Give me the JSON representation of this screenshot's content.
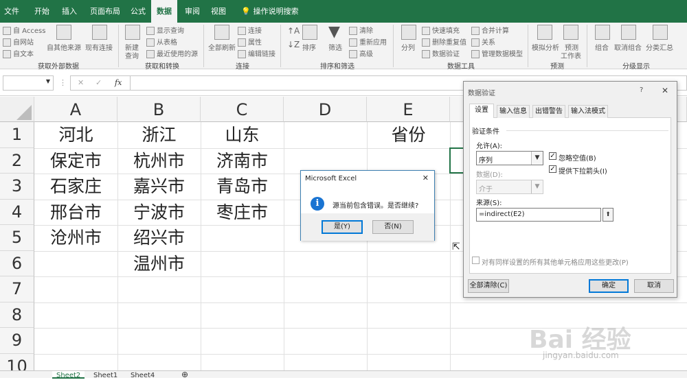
{
  "tabs": [
    "文件",
    "开始",
    "插入",
    "页面布局",
    "公式",
    "数据",
    "审阅",
    "视图",
    "操作说明搜索"
  ],
  "ribbon": {
    "external": {
      "access": "自 Access",
      "web": "自网站",
      "text": "自文本",
      "other": "自其他来源",
      "existing": "现有连接",
      "group": "获取外部数据"
    },
    "transform": {
      "new_query": "新建",
      "new_query2": "查询",
      "show_query": "显示查询",
      "from_table": "从表格",
      "recent": "最近使用的源",
      "group": "获取和转换"
    },
    "connections": {
      "refresh": "全部刷新",
      "conn": "连接",
      "props": "属性",
      "edit_links": "编辑链接",
      "group": "连接"
    },
    "sort": {
      "sort": "排序",
      "filter": "筛选",
      "clear": "清除",
      "reapply": "重新应用",
      "advanced": "高级",
      "group": "排序和筛选"
    },
    "tools": {
      "split": "分列",
      "flash": "快速填充",
      "remove_dup": "删除重复值",
      "validation": "数据验证",
      "consolidate": "合并计算",
      "relations": "关系",
      "model": "管理数据模型",
      "group": "数据工具"
    },
    "forecast": {
      "whatif": "模拟分析",
      "sheet": "预测",
      "sheet2": "工作表",
      "group": "预测"
    },
    "outline": {
      "group_btn": "组合",
      "ungroup": "取消组合",
      "subtotal": "分类汇总",
      "group": "分级显示"
    }
  },
  "formula_bar": {
    "fx": "fx"
  },
  "columns": [
    "A",
    "B",
    "C",
    "D",
    "E"
  ],
  "rows": [
    "1",
    "2",
    "3",
    "4",
    "5",
    "6",
    "7",
    "8",
    "9",
    "10"
  ],
  "cells": {
    "A1": "河北",
    "B1": "浙江",
    "C1": "山东",
    "E1": "省份",
    "A2": "保定市",
    "B2": "杭州市",
    "C2": "济南市",
    "A3": "石家庄",
    "B3": "嘉兴市",
    "C3": "青岛市",
    "A4": "邢台市",
    "B4": "宁波市",
    "C4": "枣庄市",
    "A5": "沧州市",
    "B5": "绍兴市",
    "B6": "温州市"
  },
  "sheets": [
    "Sheet2",
    "Sheet1",
    "Sheet4"
  ],
  "message_box": {
    "title": "Microsoft Excel",
    "text": "源当前包含错误。是否继续?",
    "yes": "是(Y)",
    "no": "否(N)",
    "close": "✕"
  },
  "data_validation": {
    "title": "数据验证",
    "help": "?",
    "close": "✕",
    "tabs": [
      "设置",
      "输入信息",
      "出错警告",
      "输入法模式"
    ],
    "criteria": "验证条件",
    "allow_label": "允许(A):",
    "allow_value": "序列",
    "data_label": "数据(D):",
    "data_value": "介于",
    "ignore_blank": "忽略空值(B)",
    "dropdown": "提供下拉箭头(I)",
    "source_label": "来源(S):",
    "source_value": "=indirect(E2)",
    "apply_all": "对有同样设置的所有其他单元格应用这些更改(P)",
    "clear_all": "全部清除(C)",
    "ok": "确定",
    "cancel": "取消"
  },
  "watermark": {
    "main": "Bai 经验",
    "sub": "jingyan.baidu.com"
  },
  "colors": {
    "excel_green": "#217346",
    "accent_blue": "#0078d7",
    "info_icon": "#1a74d2"
  }
}
